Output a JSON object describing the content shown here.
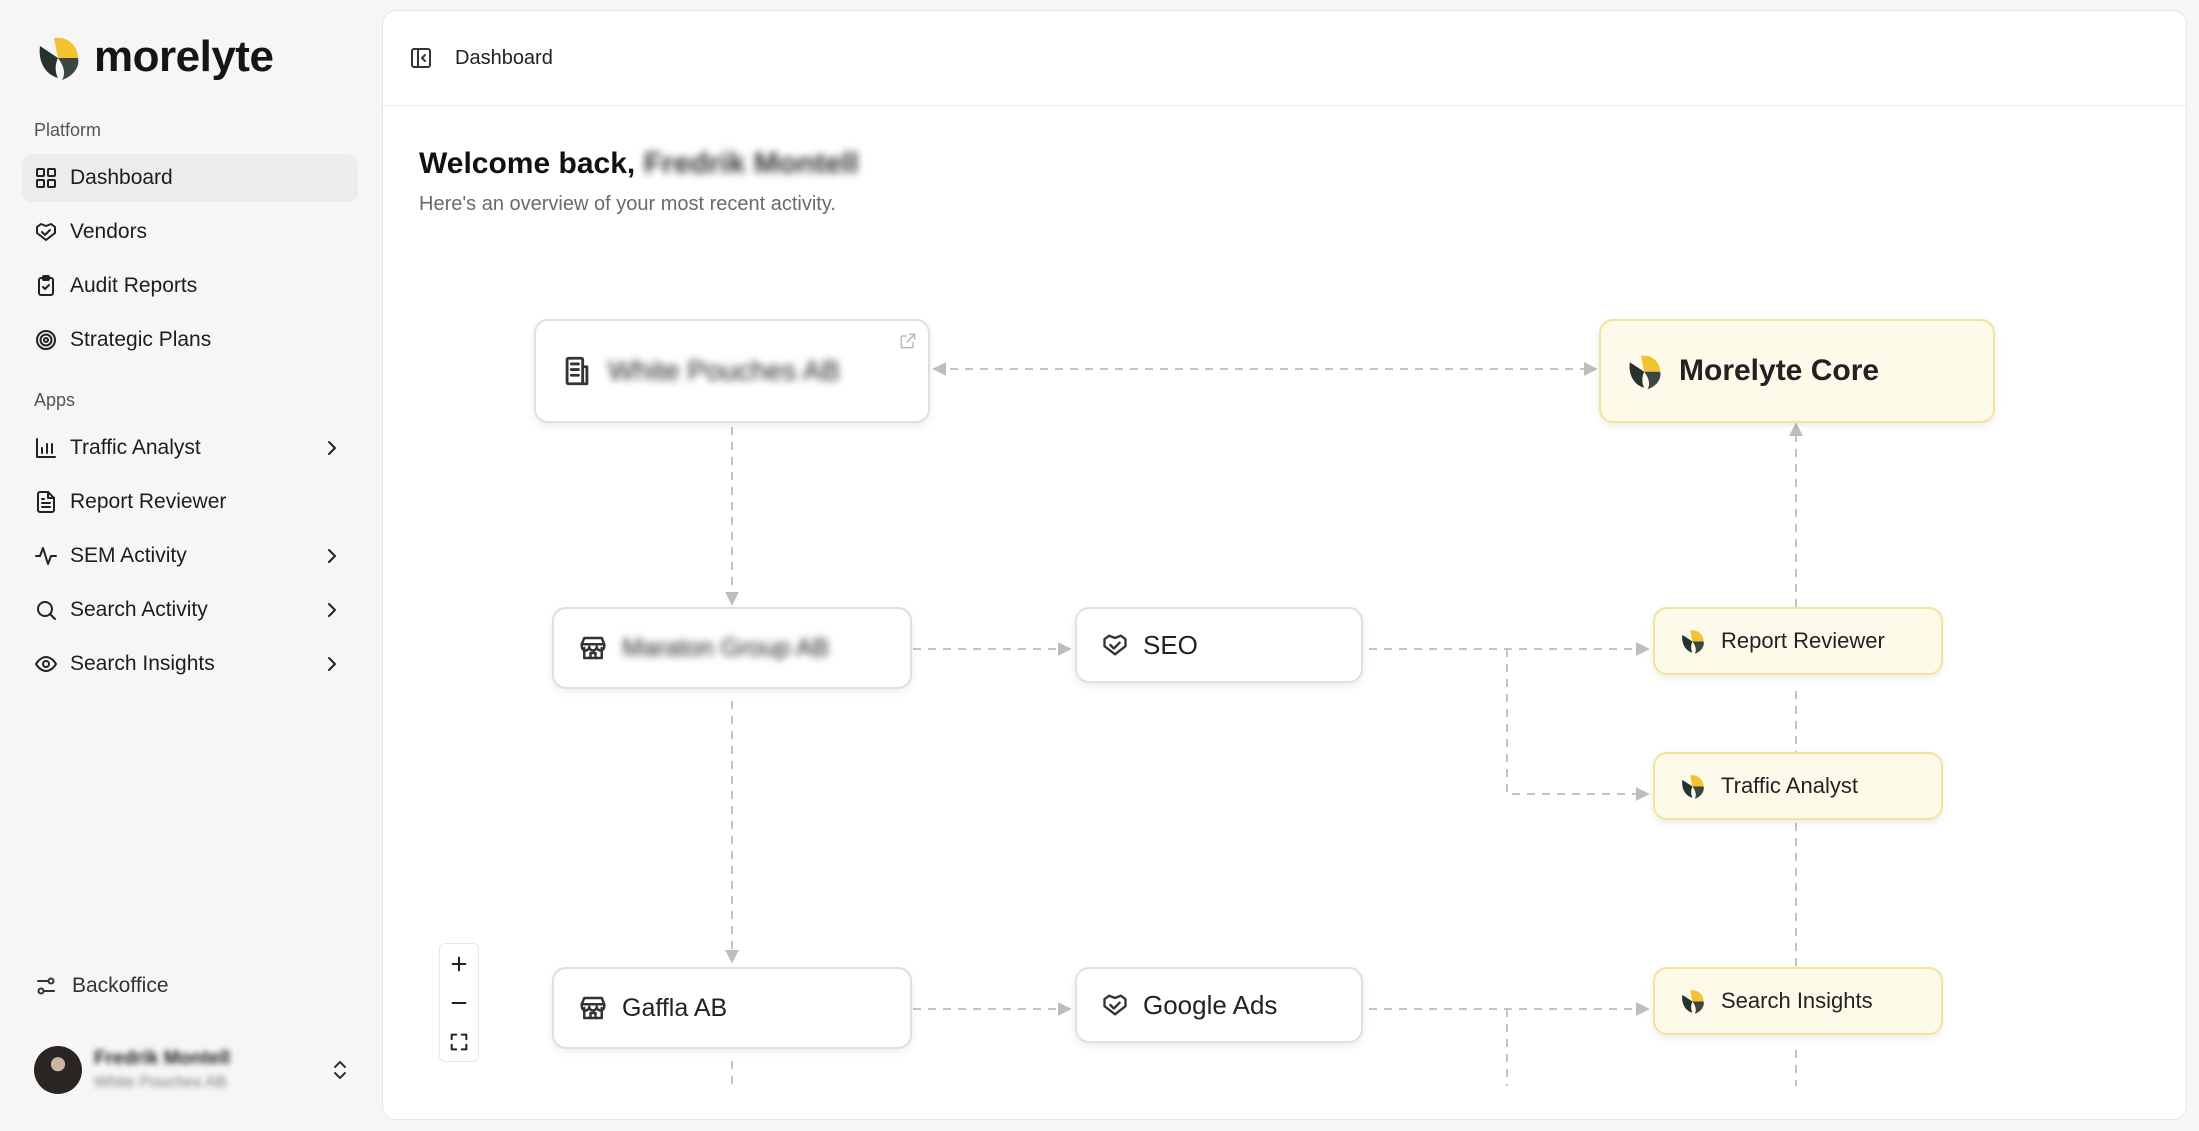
{
  "brand": {
    "name": "morelyte",
    "colors": {
      "yellow": "#f2c230",
      "dark": "#27312f",
      "app_bg": "#fefaea",
      "app_border": "#f4e39a"
    }
  },
  "sidebar": {
    "platform_label": "Platform",
    "platform_items": [
      {
        "label": "Dashboard",
        "icon": "layout-grid-icon",
        "active": true
      },
      {
        "label": "Vendors",
        "icon": "handshake-icon"
      },
      {
        "label": "Audit Reports",
        "icon": "clipboard-check-icon"
      },
      {
        "label": "Strategic Plans",
        "icon": "target-icon"
      }
    ],
    "apps_label": "Apps",
    "app_items": [
      {
        "label": "Traffic Analyst",
        "icon": "bar-chart-icon",
        "has_children": true
      },
      {
        "label": "Report Reviewer",
        "icon": "file-text-icon",
        "has_children": false
      },
      {
        "label": "SEM Activity",
        "icon": "activity-icon",
        "has_children": true
      },
      {
        "label": "Search Activity",
        "icon": "search-icon",
        "has_children": true
      },
      {
        "label": "Search Insights",
        "icon": "eye-icon",
        "has_children": true
      }
    ],
    "backoffice_label": "Backoffice",
    "user": {
      "name": "Fredrik Montell",
      "org": "White Pouches AB"
    }
  },
  "header": {
    "breadcrumb": "Dashboard"
  },
  "main": {
    "welcome_prefix": "Welcome back,",
    "welcome_name": "Fredrik Montell",
    "subtitle": "Here's an overview of your most recent activity."
  },
  "flow": {
    "nodes": {
      "company": {
        "label": "White Pouches AB",
        "icon": "building-icon"
      },
      "core": {
        "label": "Morelyte Core",
        "icon": "morelyte-logo-icon"
      },
      "vendor1": {
        "label": "Maraton Group AB",
        "icon": "store-icon"
      },
      "seo": {
        "label": "SEO",
        "icon": "handshake-icon"
      },
      "report_reviewer": {
        "label": "Report Reviewer",
        "icon": "morelyte-logo-icon"
      },
      "traffic_analyst": {
        "label": "Traffic Analyst",
        "icon": "morelyte-logo-icon"
      },
      "vendor2": {
        "label": "Gaffla AB",
        "icon": "store-icon"
      },
      "google_ads": {
        "label": "Google Ads",
        "icon": "handshake-icon"
      },
      "search_insights": {
        "label": "Search Insights",
        "icon": "morelyte-logo-icon"
      }
    },
    "controls": [
      "zoom-in",
      "zoom-out",
      "fit-view"
    ]
  }
}
